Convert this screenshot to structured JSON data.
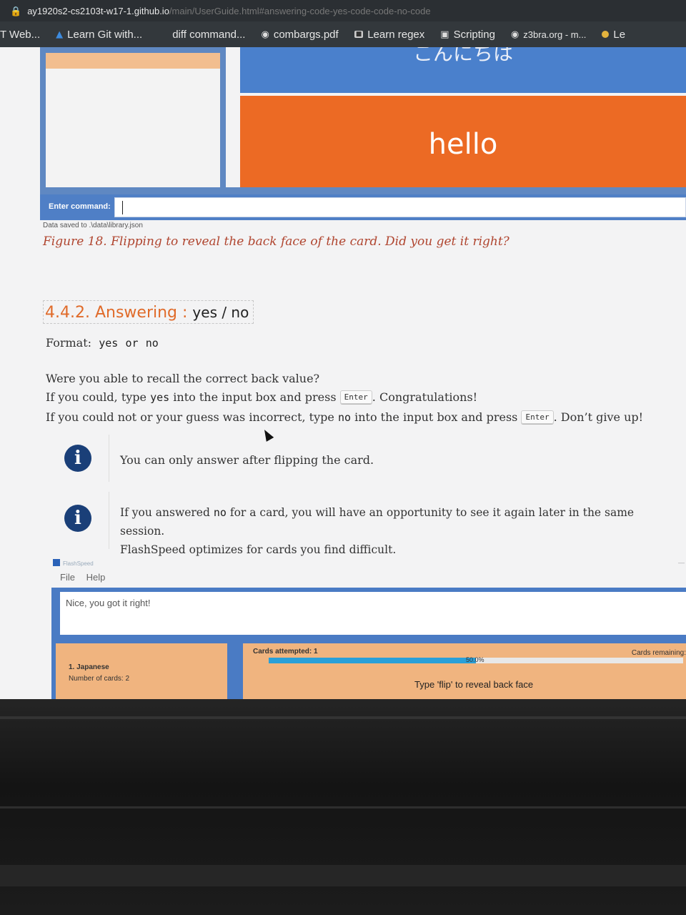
{
  "browser": {
    "url_host": "ay1920s2-cs2103t-w17-1.github.io",
    "url_path": "/main/UserGuide.html#answering-code-yes-code-code-no-code",
    "bookmarks": [
      {
        "label": "T Web...",
        "icon": ""
      },
      {
        "label": "Learn Git with...",
        "icon": "triangle-icon"
      },
      {
        "label": "diff command...",
        "icon": ""
      },
      {
        "label": "combargs.pdf",
        "icon": "globe-icon"
      },
      {
        "label": "Learn regex",
        "icon": "square-icon"
      },
      {
        "label": "Scripting",
        "icon": "app-icon"
      },
      {
        "label": "z3bra.org - m...",
        "icon": "globe-icon"
      },
      {
        "label": "Le",
        "icon": "dot-icon"
      }
    ]
  },
  "figure_top": {
    "card_front_partial": "こんにちは",
    "card_back": "hello",
    "command_label": "Enter command:",
    "status": "Data saved to .\\data\\library.json"
  },
  "caption": "Figure 18. Flipping to reveal the back face of the card. Did you get it right?",
  "section": {
    "number_title": "4.4.2. Answering :",
    "code": "yes / no",
    "format_label": "Format:",
    "format_yes": "yes",
    "format_or": "or",
    "format_no": "no",
    "question": "Were you able to recall the correct back value?",
    "line2_pre": "If you could, type",
    "line2_code": "yes",
    "line2_mid": "into the input box and press",
    "line2_key": "Enter",
    "line2_post": ". Congratulations!",
    "line3_pre": "If you could not or your guess was incorrect, type",
    "line3_code": "no",
    "line3_mid": "into the input box and press",
    "line3_key": "Enter",
    "line3_post": ". Don’t give up!"
  },
  "notes": [
    {
      "text": "You can only answer after flipping the card."
    },
    {
      "pre": "If you answered",
      "code": "no",
      "post": "for a card, you will have an opportunity to see it again later in the same session.",
      "line2": "FlashSpeed optimizes for cards you find difficult."
    }
  ],
  "app": {
    "title": "FlashSpeed",
    "menu": [
      "File",
      "Help"
    ],
    "response": "Nice, you got it right!",
    "list_item": "1.  Japanese",
    "list_count": "Number of cards: 2",
    "attempted": "Cards attempted: 1",
    "remaining": "Cards remaining:",
    "progress_label": "50.0%",
    "progress": 0.5,
    "hint": "Type 'flip' to reveal back face"
  }
}
